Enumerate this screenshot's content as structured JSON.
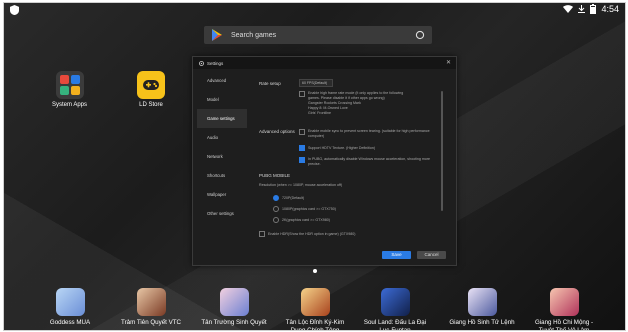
{
  "statusbar": {
    "time": "4:54"
  },
  "search": {
    "placeholder": "Search games"
  },
  "desktop": [
    {
      "label": "System Apps"
    },
    {
      "label": "LD Store"
    }
  ],
  "settings": {
    "title": "Settings",
    "sidebar": [
      "Advanced",
      "Model",
      "Game settings",
      "Audio",
      "Network",
      "Shortcuts",
      "Wallpaper",
      "Other settings"
    ],
    "active_index": 2,
    "rate_setup": {
      "label": "Rate setup",
      "value": "60 FPS(Default)"
    },
    "hint_lines": [
      "Enable high frame rate mode (it only applies to the following",
      "games. Please disable it if other apps go wrong)",
      "Gangster Rockets Crossing Mark",
      "Happy 8: M-Owned Love",
      "Girls' Frontline"
    ],
    "advanced": {
      "label": "Advanced options",
      "opt1": "Enable mobile sync to prevent screen tearing. (suitable for high performance computer)",
      "opt2": "Support HDTV Texture. (Higher Definition)",
      "opt3": "In PUBG, automatically disable Windows mouse acceleration, shooting more precise."
    },
    "pubg": {
      "title": "PUBG MOBILE",
      "desc": "Resolution (when >= 1080P, mouse acceleration off)",
      "r1": "720P(Default)",
      "r2": "1080P(graphics card >= GTX750)",
      "r3": "2K(graphics card >= GTX980)",
      "hdr": "Enable HDR(Show the HDR option in game) (GTX980)"
    },
    "buttons": {
      "save": "Save",
      "cancel": "Cancel"
    }
  },
  "dock": [
    {
      "label": "Goddess MUA"
    },
    {
      "label": "Trảm Tiên Quyết VTC"
    },
    {
      "label": "Tân Trường Sinh Quyết"
    },
    {
      "label": "Tân Lộc Đỉnh Ký-Kim\nDung Chính Tông"
    },
    {
      "label": "Soul Land: Đấu La Đại\nLục-Funtap"
    },
    {
      "label": "Giang Hồ Sinh Tử Lệnh"
    },
    {
      "label": "Giang Hồ Chi Mộng -\nTuyệt Thế Vô Lâm"
    }
  ],
  "colors": {
    "accent": "#2a7be4"
  }
}
